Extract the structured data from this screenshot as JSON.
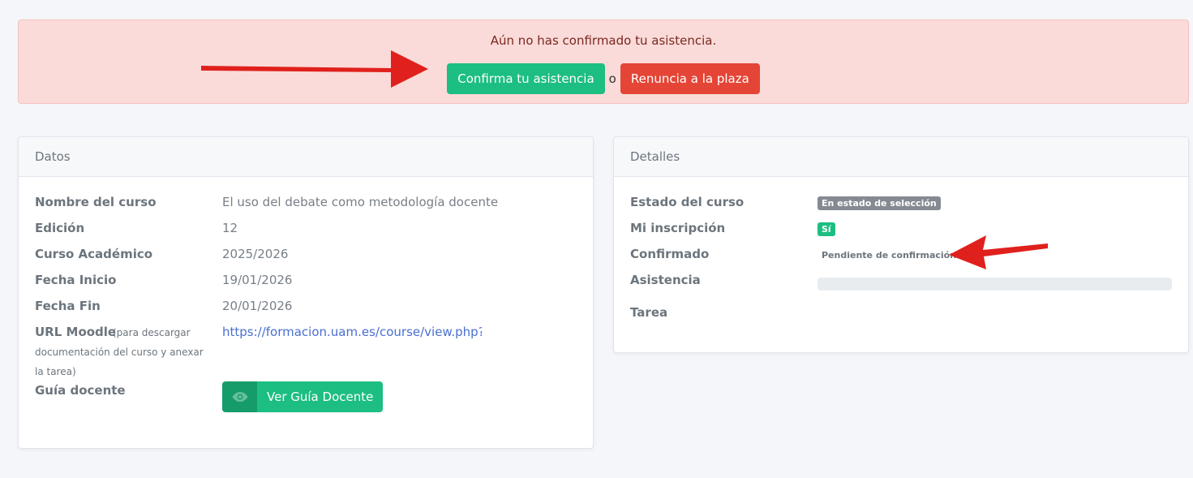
{
  "alert": {
    "message": "Aún no has confirmado tu asistencia.",
    "confirm_label": "Confirma tu asistencia",
    "or_text": "o",
    "renounce_label": "Renuncia a la plaza"
  },
  "datos": {
    "title": "Datos",
    "rows": [
      {
        "label": "Nombre del curso",
        "value": "El uso del debate como metodología docente"
      },
      {
        "label": "Edición",
        "value": "12"
      },
      {
        "label": "Curso Académico",
        "value": "2025/2026"
      },
      {
        "label": "Fecha Inicio",
        "value": "19/01/2026"
      },
      {
        "label": "Fecha Fin",
        "value": "20/01/2026"
      }
    ],
    "moodle": {
      "label": "URL Moodle",
      "note_line1": "(para descargar",
      "note_line2": "documentación del curso y anexar",
      "note_line3": "la tarea)",
      "value": "https://formacion.uam.es/course/view.php?id="
    },
    "guia": {
      "label": "Guía docente",
      "button_label": "Ver Guía Docente",
      "icon": "eye-icon"
    }
  },
  "detalles": {
    "title": "Detalles",
    "estado_label": "Estado del curso",
    "estado_value": "En estado de selección",
    "inscripcion_label": "Mi inscripción",
    "inscripcion_value": "Sí",
    "confirmado_label": "Confirmado",
    "confirmado_value": "Pendiente de confirmación",
    "asistencia_label": "Asistencia",
    "asistencia_progress": 0,
    "tarea_label": "Tarea"
  },
  "colors": {
    "success": "#1cbe82",
    "danger": "#e44536",
    "annotation_arrow": "#e0201c"
  }
}
